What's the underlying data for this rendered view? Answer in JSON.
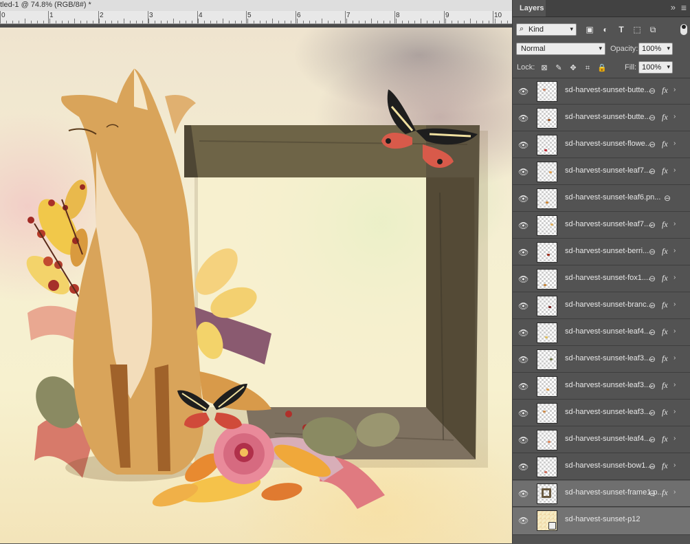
{
  "document": {
    "tab_title": "tled-1 @ 74.8% (RGB/8#) *",
    "ruler_numbers": [
      "0",
      "1",
      "2",
      "3",
      "4",
      "5",
      "6",
      "7",
      "8",
      "9",
      "10"
    ]
  },
  "panel": {
    "tab_label": "Layers",
    "collapse_glyph": "»",
    "menu_glyph": "≡",
    "filter": {
      "kind_label": "Kind",
      "icons": [
        "image-filter-icon",
        "adjustment-filter-icon",
        "type-filter-icon",
        "shape-filter-icon",
        "smart-object-filter-icon"
      ]
    },
    "blend_mode": "Normal",
    "opacity_label": "Opacity:",
    "opacity_value": "100%",
    "lock_label": "Lock:",
    "fill_label": "Fill:",
    "fill_value": "100%"
  },
  "layers": [
    {
      "name": "sd-harvest-sunset-butte...",
      "link": "⊖",
      "fx": "fx",
      "chevron": "›",
      "mark": "#d08a6a"
    },
    {
      "name": "sd-harvest-sunset-butte...",
      "link": "⊖",
      "fx": "fx",
      "chevron": "›",
      "mark": "#a15a2a"
    },
    {
      "name": "sd-harvest-sunset-flowe...",
      "link": "⊖",
      "fx": "fx",
      "chevron": "›",
      "mark": "#c0303a"
    },
    {
      "name": "sd-harvest-sunset-leaf7....",
      "link": "⊖",
      "fx": "fx",
      "chevron": "›",
      "mark": "#e0a050"
    },
    {
      "name": "sd-harvest-sunset-leaf6.pn...",
      "link": "⊖",
      "fx": "",
      "chevron": "",
      "mark": "#d08a3a"
    },
    {
      "name": "sd-harvest-sunset-leaf7....",
      "link": "⊖",
      "fx": "fx",
      "chevron": "›",
      "mark": "#e0b060"
    },
    {
      "name": "sd-harvest-sunset-berri...",
      "link": "⊖",
      "fx": "fx",
      "chevron": "›",
      "mark": "#a03020"
    },
    {
      "name": "sd-harvest-sunset-fox1....",
      "link": "⊖",
      "fx": "fx",
      "chevron": "›",
      "mark": "#c88a40"
    },
    {
      "name": "sd-harvest-sunset-branc...",
      "link": "⊖",
      "fx": "fx",
      "chevron": "›",
      "mark": "#7a2020"
    },
    {
      "name": "sd-harvest-sunset-leaf4....",
      "link": "⊖",
      "fx": "fx",
      "chevron": "›",
      "mark": "#e0c060"
    },
    {
      "name": "sd-harvest-sunset-leaf3....",
      "link": "⊖",
      "fx": "fx",
      "chevron": "›",
      "mark": "#7a8050"
    },
    {
      "name": "sd-harvest-sunset-leaf3....",
      "link": "⊖",
      "fx": "fx",
      "chevron": "›",
      "mark": "#e0a050"
    },
    {
      "name": "sd-harvest-sunset-leaf3....",
      "link": "⊖",
      "fx": "fx",
      "chevron": "›",
      "mark": "#d09050"
    },
    {
      "name": "sd-harvest-sunset-leaf4....",
      "link": "⊖",
      "fx": "fx",
      "chevron": "›",
      "mark": "#e08a60"
    },
    {
      "name": "sd-harvest-sunset-bow1....",
      "link": "⊖",
      "fx": "fx",
      "chevron": "›",
      "mark": "#d07060"
    },
    {
      "name": "sd-harvest-sunset-frame1.p...",
      "link": "⊖",
      "fx": "fx",
      "chevron": "›",
      "mark": "#6a5a40"
    },
    {
      "name": "sd-harvest-sunset-p12",
      "link": "",
      "fx": "",
      "chevron": "",
      "mark": "#f0d090"
    }
  ]
}
